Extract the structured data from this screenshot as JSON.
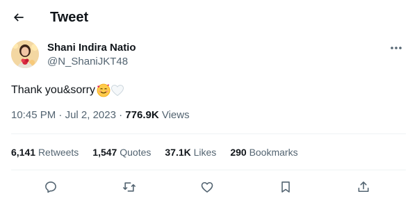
{
  "header": {
    "title": "Tweet",
    "back_icon": "arrow-left-icon"
  },
  "author": {
    "name": "Shani Indira Natio",
    "handle": "@N_ShaniJKT48"
  },
  "tweet": {
    "text": "Thank you&sorry",
    "emojis": [
      "smiling-face-with-hearts-icon",
      "white-heart-icon"
    ],
    "time": "10:45 PM",
    "separator_1": "·",
    "date": "Jul 2, 2023",
    "separator_2": "·",
    "views_count": "776.9K",
    "views_label": "Views"
  },
  "stats": {
    "retweets": {
      "count": "6,141",
      "label": "Retweets"
    },
    "quotes": {
      "count": "1,547",
      "label": "Quotes"
    },
    "likes": {
      "count": "37.1K",
      "label": "Likes"
    },
    "bookmarks": {
      "count": "290",
      "label": "Bookmarks"
    }
  },
  "actions": [
    "reply-icon",
    "retweet-icon",
    "like-icon",
    "bookmark-icon",
    "share-icon"
  ],
  "colors": {
    "text_primary": "#0f1419",
    "text_secondary": "#536471",
    "divider": "#eff3f4"
  }
}
